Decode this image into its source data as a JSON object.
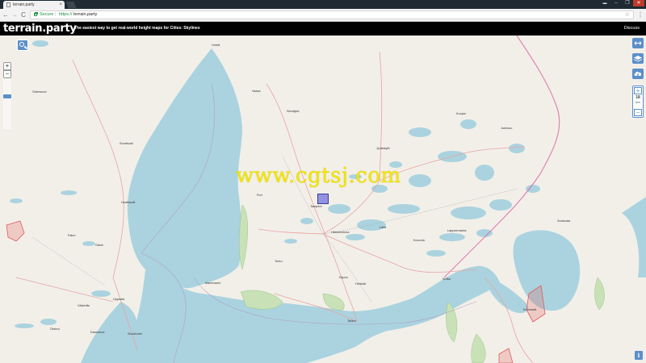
{
  "browser": {
    "tab_title": "terrain.party",
    "tab_close": "×",
    "secure_label": "Secure",
    "url_separator": "|",
    "url_scheme": "https://",
    "url_host": "terrain.party",
    "back": "←",
    "forward": "→",
    "reload": "C",
    "star": "☆",
    "menu": "⋮",
    "window_min": "–",
    "window_max": "❐",
    "window_close": "✕",
    "window_user": "▬"
  },
  "app": {
    "brand": "terrain.party",
    "tagline_prefix": "The easiest way to get real-world height maps for ",
    "tagline_game": "Cities: Skylines",
    "discuss": "Discuss"
  },
  "controls": {
    "zoom_in": "+",
    "zoom_out": "−",
    "grow": "+",
    "shrink": "−",
    "size_value": "18",
    "size_unit": "km",
    "info": "i",
    "zoom_level_fraction": 0.33
  },
  "map": {
    "watermark": "www.cgtsj.com",
    "labels": [
      {
        "name": "Umeå",
        "cls": "t1"
      },
      {
        "name": "Vaasa",
        "cls": "t2"
      },
      {
        "name": "Seinäjoki",
        "cls": "t3"
      },
      {
        "name": "Östersund",
        "cls": "t4"
      },
      {
        "name": "Sundsvall",
        "cls": "t5"
      },
      {
        "name": "Jyväskylä",
        "cls": "t6"
      },
      {
        "name": "Kuopio",
        "cls": "t7"
      },
      {
        "name": "Joensuu",
        "cls": "t8"
      },
      {
        "name": "Pori",
        "cls": "t9"
      },
      {
        "name": "Tampere",
        "cls": "t10"
      },
      {
        "name": "Hämeenlinna",
        "cls": "t11"
      },
      {
        "name": "Lahti",
        "cls": "t12"
      },
      {
        "name": "Kouvola",
        "cls": "t13"
      },
      {
        "name": "Lappeenranta",
        "cls": "t14"
      },
      {
        "name": "Turku",
        "cls": "t15"
      },
      {
        "name": "Espoo",
        "cls": "t16"
      },
      {
        "name": "Helsinki",
        "cls": "t17"
      },
      {
        "name": "Tallinn",
        "cls": "t18"
      },
      {
        "name": "Falun",
        "cls": "t19"
      },
      {
        "name": "Gävle",
        "cls": "t20"
      },
      {
        "name": "Uppsala",
        "cls": "t21"
      },
      {
        "name": "Västerås",
        "cls": "t22"
      },
      {
        "name": "Örebro",
        "cls": "t23"
      },
      {
        "name": "Eskilstuna",
        "cls": "t24"
      },
      {
        "name": "Stockholm",
        "cls": "t25"
      },
      {
        "name": "Hudiksvall",
        "cls": "t26"
      },
      {
        "name": "Kotka",
        "cls": "t27"
      },
      {
        "name": "Kronstadt",
        "cls": "t28"
      },
      {
        "name": "Mariehamn",
        "cls": "t29"
      },
      {
        "name": "Sortavala",
        "cls": "t30"
      }
    ]
  }
}
